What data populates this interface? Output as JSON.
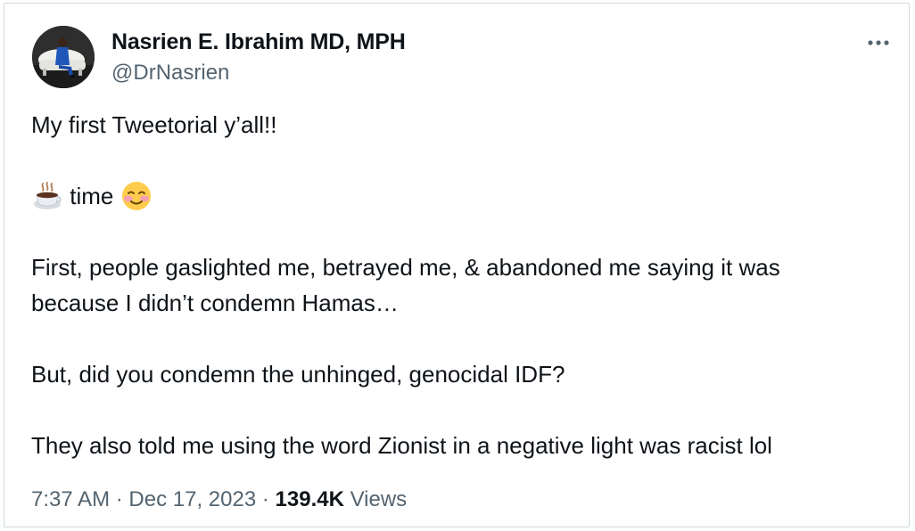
{
  "author": {
    "display_name": "Nasrien E. Ibrahim MD, MPH",
    "handle": "@DrNasrien",
    "avatar_icon": "profile-photo"
  },
  "more_options_icon": "ellipsis-icon",
  "tweet": {
    "line1": "My first Tweetorial y’all!!",
    "line2_icon1": "hot-beverage-emoji",
    "line2_text": "time",
    "line2_icon2": "smiling-face-emoji",
    "line3a": "First, people gaslighted me, betrayed me, & abandoned me saying it was",
    "line3b": "because I didn’t condemn Hamas…",
    "line4": "But, did you condemn the unhinged, genocidal IDF?",
    "line5": "They also told me using the word Zionist in a negative light was racist lol"
  },
  "meta": {
    "time": "7:37 AM",
    "separator1": "·",
    "date": "Dec 17, 2023",
    "separator2": "·",
    "views_count": "139.4K",
    "views_label": "Views"
  },
  "colors": {
    "text": "#0f1419",
    "secondary": "#536471",
    "border": "#cfd9de"
  }
}
